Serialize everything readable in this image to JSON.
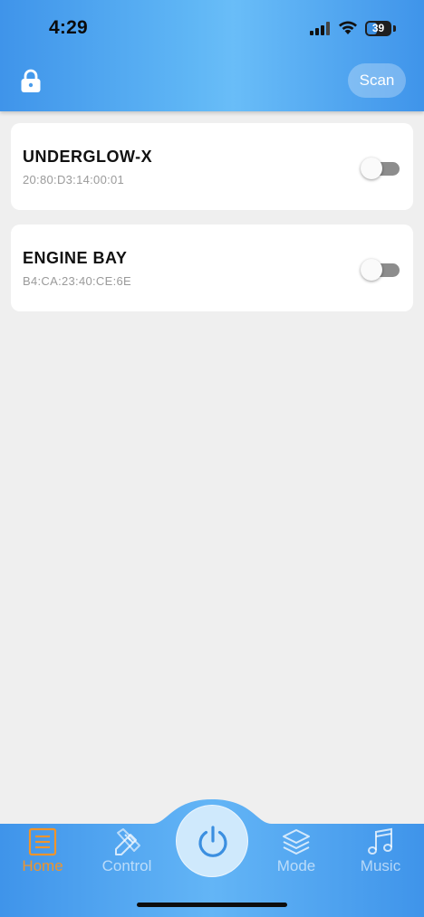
{
  "status_bar": {
    "time": "4:29",
    "battery_level": "39"
  },
  "header": {
    "scan_label": "Scan"
  },
  "devices": [
    {
      "name": "UNDERGLOW-X",
      "mac": "20:80:D3:14:00:01",
      "enabled": false
    },
    {
      "name": "ENGINE BAY",
      "mac": "B4:CA:23:40:CE:6E",
      "enabled": false
    }
  ],
  "tabs": [
    {
      "label": "Home",
      "icon": "list-icon",
      "active": true
    },
    {
      "label": "Control",
      "icon": "pencil-ruler-icon",
      "active": false
    },
    {
      "label": "Mode",
      "icon": "layers-icon",
      "active": false
    },
    {
      "label": "Music",
      "icon": "music-note-icon",
      "active": false
    }
  ],
  "power_button": {
    "icon": "power-icon"
  },
  "colors": {
    "header_gradient_edge": "#3f94ea",
    "header_gradient_center": "#69bdf8",
    "tab_active": "#f0942a",
    "toggle_off": "#8d8d8d",
    "background": "#efefef"
  }
}
